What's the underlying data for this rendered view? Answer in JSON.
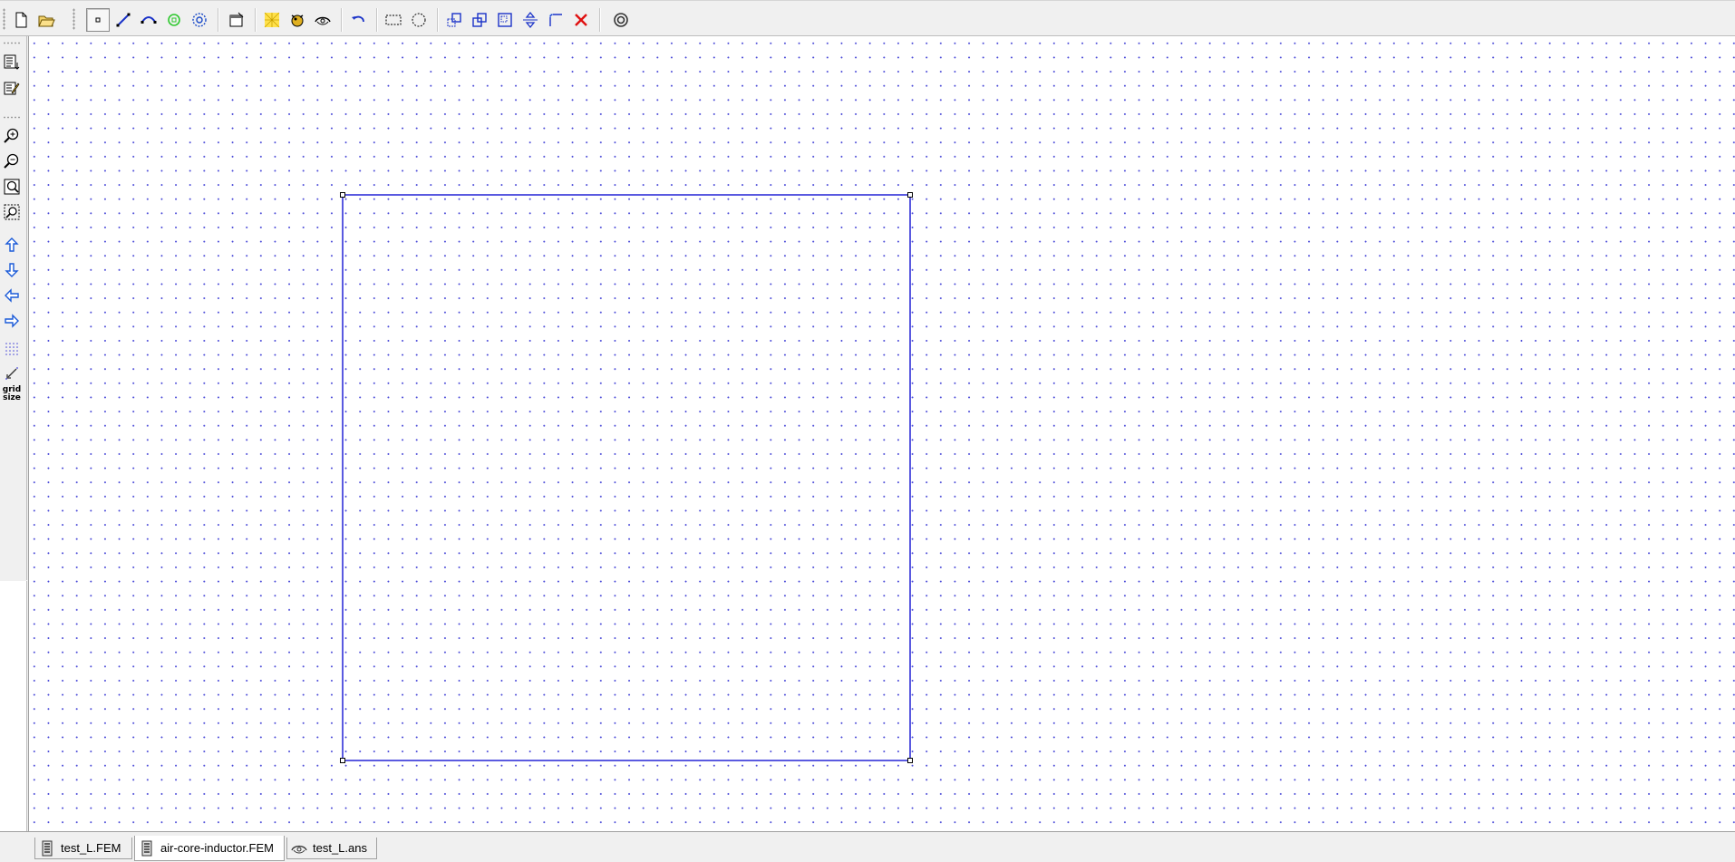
{
  "toolbar": {
    "buttons": [
      {
        "name": "new-document-icon"
      },
      {
        "name": "open-folder-icon"
      },
      {
        "name": "node-mode-icon",
        "pressed": true
      },
      {
        "name": "segment-mode-icon"
      },
      {
        "name": "arc-segment-mode-icon"
      },
      {
        "name": "block-label-mode-icon"
      },
      {
        "name": "group-mode-icon"
      },
      {
        "name": "properties-icon"
      },
      {
        "name": "mesh-icon"
      },
      {
        "name": "run-analysis-icon"
      },
      {
        "name": "view-results-icon"
      },
      {
        "name": "undo-icon"
      },
      {
        "name": "select-rectangle-icon"
      },
      {
        "name": "select-circle-icon"
      },
      {
        "name": "move-icon"
      },
      {
        "name": "copy-icon"
      },
      {
        "name": "scale-icon"
      },
      {
        "name": "mirror-icon"
      },
      {
        "name": "fillet-icon"
      },
      {
        "name": "delete-icon"
      },
      {
        "name": "create-radius-icon"
      }
    ]
  },
  "left_toolbar": {
    "buttons": [
      {
        "name": "list-icon"
      },
      {
        "name": "edit-properties-icon"
      },
      {
        "name": "zoom-in-icon"
      },
      {
        "name": "zoom-out-icon"
      },
      {
        "name": "zoom-natural-icon"
      },
      {
        "name": "zoom-window-icon"
      },
      {
        "name": "pan-up-icon"
      },
      {
        "name": "pan-down-icon"
      },
      {
        "name": "pan-left-icon"
      },
      {
        "name": "pan-right-icon"
      },
      {
        "name": "show-grid-icon"
      },
      {
        "name": "snap-grid-icon"
      }
    ],
    "grid_size_label": "grid size"
  },
  "canvas": {
    "grid_color": "#4a4ad8",
    "geometry_color": "#2424d6",
    "shape": "square with four corner nodes"
  },
  "tabs": [
    {
      "label": "test_L.FEM",
      "icon": "magnetics-document-icon",
      "active": false
    },
    {
      "label": "air-core-inductor.FEM",
      "icon": "magnetics-document-icon",
      "active": true
    },
    {
      "label": "test_L.ans",
      "icon": "solution-document-icon",
      "active": false
    }
  ]
}
